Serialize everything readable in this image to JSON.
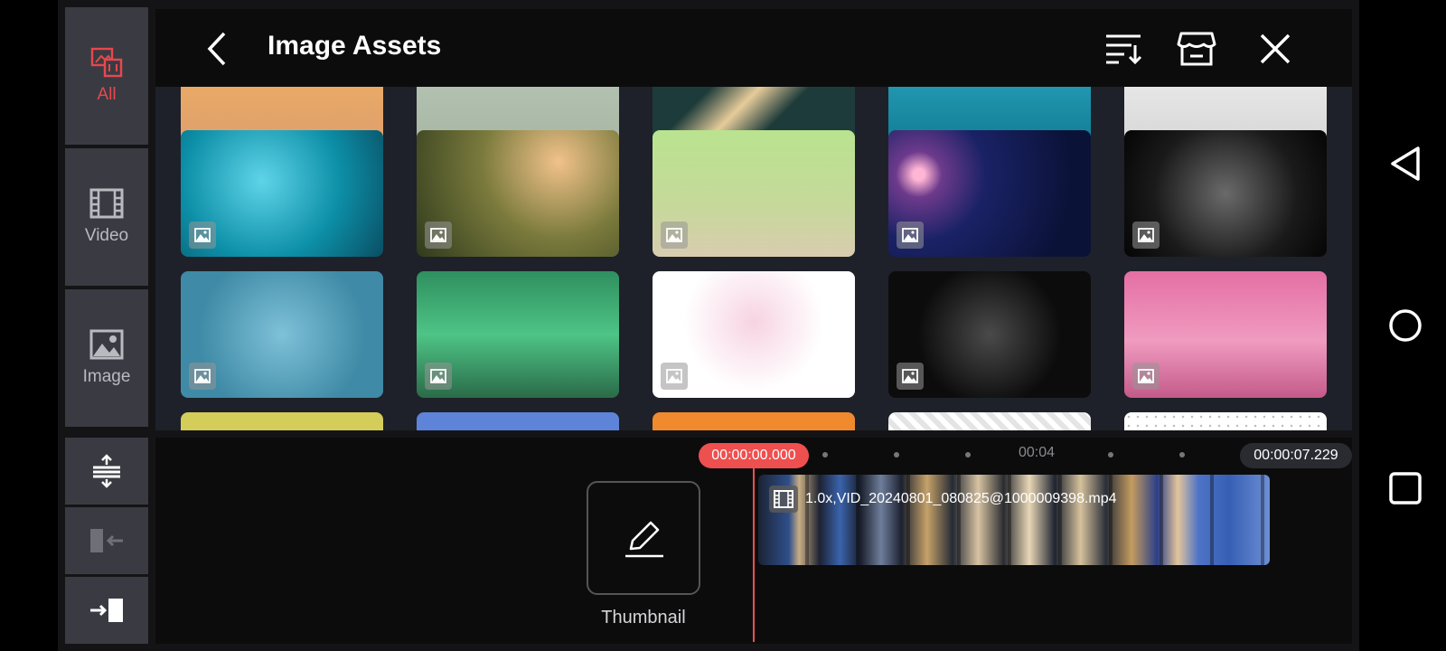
{
  "header": {
    "title": "Image Assets",
    "back_icon": "chevron-left-icon",
    "sort_icon": "sort-icon",
    "store_icon": "store-icon",
    "close_icon": "close-icon"
  },
  "rail": {
    "items": [
      {
        "label": "All",
        "icon": "all-media-icon",
        "active": true
      },
      {
        "label": "Video",
        "icon": "film-icon",
        "active": false
      },
      {
        "label": "Image",
        "icon": "image-icon",
        "active": false
      }
    ]
  },
  "grid": {
    "tiles": [
      {
        "name": "bokeh-gold",
        "bg": "linear-gradient(180deg,#f0b062,#d99a70)"
      },
      {
        "name": "soft-green",
        "bg": "linear-gradient(180deg,#b9c7b7,#a3b39f)"
      },
      {
        "name": "diamond-frame",
        "bg": "linear-gradient(135deg,#1d3b3a 30%,#e6cc9a 45%,#1d3b3a 60%)"
      },
      {
        "name": "teal-sea",
        "bg": "linear-gradient(180deg,#2aa9c1,#0b6f87)"
      },
      {
        "name": "white-gray",
        "bg": "linear-gradient(180deg,#f1f1f1,#cfcfcf)"
      },
      {
        "name": "underwater-bubbles",
        "bg": "radial-gradient(circle at 40% 40%,#5fd4e8,#0c8fa7 55%,#0a4e63)"
      },
      {
        "name": "grass-bokeh",
        "bg": "radial-gradient(circle at 70% 25%,#f1c28a,#7a7a3c 45%,#2f3a1c)"
      },
      {
        "name": "light-green",
        "bg": "linear-gradient(180deg,#b9e38f,#c6d99a 60%,#d9ccb0)"
      },
      {
        "name": "blue-lens-flare",
        "bg": "radial-gradient(circle at 15% 35%,#ffb5d4 3%,#6d3a8c 12%,#1a2266 35%,#0b1238 80%)"
      },
      {
        "name": "black-ornament",
        "bg": "radial-gradient(circle at 50% 50%,#6a6a6a,#1a1a1a 60%,#050505)"
      },
      {
        "name": "blue-globe",
        "bg": "radial-gradient(circle at 50% 50%,#7ec1d8,#3f8aa6 70%)"
      },
      {
        "name": "green-trees",
        "bg": "linear-gradient(180deg,#2f8f5f,#4ec486 50%,#2a6b48)"
      },
      {
        "name": "hearts",
        "bg": "radial-gradient(circle at 50% 40%,#f7d3e2,#ffffff 55%)"
      },
      {
        "name": "black-frame",
        "bg": "radial-gradient(circle at 50% 50%,#4a4a4a,#0c0c0c 60%)"
      },
      {
        "name": "pink-gradient",
        "bg": "linear-gradient(180deg,#e46fa4,#f09bc0 55%,#c45a8a)"
      },
      {
        "name": "yellow",
        "bg": "#d4cd5a"
      },
      {
        "name": "blue",
        "bg": "#5d84d9"
      },
      {
        "name": "orange",
        "bg": "#f1892e"
      },
      {
        "name": "checker",
        "bg": "repeating-linear-gradient(45deg,#ffffff 0,#ffffff 6px,#e4e4e4 6px,#e4e4e4 12px)"
      },
      {
        "name": "white-dots",
        "bg": "radial-gradient(circle,#bbb 1px,#ffffff 1.5px)"
      }
    ]
  },
  "timeline": {
    "current_time": "00:00:00.000",
    "end_time": "00:00:07.229",
    "tick_label": "00:04",
    "clip_name": "1.0x,VID_20240801_080825@1000009398.mp4",
    "thumbnail_label": "Thumbnail"
  },
  "tools": {
    "items": [
      {
        "icon": "fit-timeline-icon"
      },
      {
        "icon": "trim-left-icon"
      },
      {
        "icon": "trim-right-icon"
      }
    ]
  },
  "nav": {
    "back": "nav-back-icon",
    "home": "nav-home-icon",
    "recents": "nav-recents-icon"
  },
  "colors": {
    "accent": "#ee4f4f",
    "rail_bg": "#3a3b42",
    "header_bg": "#0c0c0d",
    "grid_bg": "#1e2129"
  }
}
